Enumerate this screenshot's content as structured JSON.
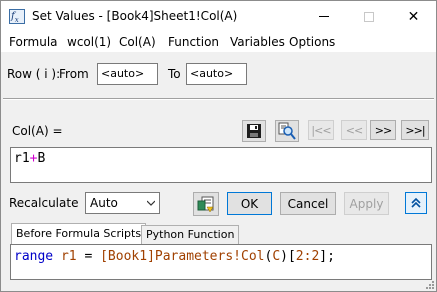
{
  "window": {
    "title": "Set Values - [Book4]Sheet1!Col(A)",
    "close_glyph": "✕"
  },
  "menu": {
    "items": [
      "Formula",
      "wcol(1)",
      "Col(A)",
      "Function",
      "Variables",
      "Options"
    ]
  },
  "row_range": {
    "label": "Row ( i ):",
    "from_label": "From",
    "from_value": "<auto>",
    "to_label": "To",
    "to_value": "<auto>"
  },
  "formula": {
    "label": "Col(A) =",
    "tokens": [
      {
        "text": "r1",
        "kind": "var"
      },
      {
        "text": "+",
        "kind": "op"
      },
      {
        "text": "B",
        "kind": "var"
      }
    ]
  },
  "nav_buttons": [
    "|<<",
    "<<",
    ">>",
    ">>|"
  ],
  "recalculate": {
    "label": "Recalculate",
    "selected": "Auto"
  },
  "buttons": {
    "ok": "OK",
    "cancel": "Cancel",
    "apply": "Apply",
    "collapse_glyph": "⌃"
  },
  "tabs": [
    "Before Formula Scripts",
    "Python Function"
  ],
  "script": {
    "tokens": [
      {
        "text": "range",
        "kind": "kw"
      },
      {
        "text": " ",
        "kind": "sp"
      },
      {
        "text": "r1",
        "kind": "ident"
      },
      {
        "text": " = ",
        "kind": "op"
      },
      {
        "text": "[Book1]Parameters!Col",
        "kind": "ident"
      },
      {
        "text": "(",
        "kind": "punct"
      },
      {
        "text": "C",
        "kind": "ident"
      },
      {
        "text": ")[",
        "kind": "punct"
      },
      {
        "text": "2:2",
        "kind": "ident"
      },
      {
        "text": "];",
        "kind": "punct"
      }
    ]
  },
  "colors": {
    "accent": "#0078d7",
    "operator": "#d000d0",
    "keyword": "#0000c8",
    "identifier": "#a04000"
  }
}
